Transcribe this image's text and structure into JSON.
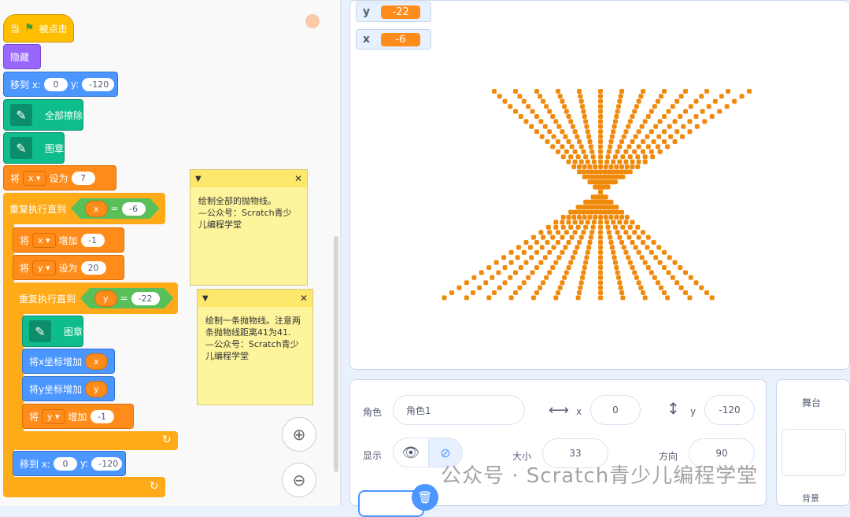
{
  "blocks": {
    "when_flag": {
      "pre": "当",
      "post": "被点击"
    },
    "hide": "隐藏",
    "goto1": {
      "label": "移到 x:",
      "x": "0",
      "ylabel": "y:",
      "y": "-120"
    },
    "clear": "全部擦除",
    "stamp1": "图章",
    "setx": {
      "pre": "将",
      "var": "x ▾",
      "mid": "设为",
      "val": "7"
    },
    "repeat1": {
      "label": "重复执行直到",
      "var": "x",
      "op": "=",
      "val": "-6"
    },
    "changex": {
      "pre": "将",
      "var": "x ▾",
      "mid": "增加",
      "val": "-1"
    },
    "sety": {
      "pre": "将",
      "var": "y ▾",
      "mid": "设为",
      "val": "20"
    },
    "repeat2": {
      "label": "重复执行直到",
      "var": "y",
      "op": "=",
      "val": "-22"
    },
    "stamp2": "图章",
    "changexcoord": {
      "label": "将x坐标增加",
      "var": "x"
    },
    "changeycoord": {
      "label": "将y坐标增加",
      "var": "y"
    },
    "changey": {
      "pre": "将",
      "var": "y ▾",
      "mid": "增加",
      "val": "-1"
    },
    "goto2": {
      "label": "移到 x:",
      "x": "0",
      "ylabel": "y:",
      "y": "-120"
    }
  },
  "notes": [
    {
      "text": "绘制全部的抛物线。\n—公众号：Scratch青少儿编程学堂"
    },
    {
      "text": "绘制一条抛物线。注意两条抛物线距离41为41.\n—公众号：Scratch青少儿编程学堂"
    }
  ],
  "stage": {
    "monitors": [
      {
        "name": "y",
        "value": "-22"
      },
      {
        "name": "x",
        "value": "-6"
      }
    ]
  },
  "sprite_panel": {
    "sprite_label": "角色",
    "sprite_name": "角色1",
    "x_label": "x",
    "x_value": "0",
    "y_label": "y",
    "y_value": "-120",
    "show_label": "显示",
    "size_label": "大小",
    "size_value": "33",
    "direction_label": "方向",
    "direction_value": "90"
  },
  "stage_panel": {
    "title": "舞台",
    "backdrop_label": "背景"
  },
  "watermark": "公众号 · Scratch青少儿编程学堂",
  "colors": {
    "events": "#ffbf00",
    "looks": "#9966ff",
    "motion": "#4c97ff",
    "pen": "#0fbd8c",
    "variables": "#ff8c1a",
    "control": "#ffab19",
    "operators": "#59c059",
    "dots": "#f08a0c"
  }
}
